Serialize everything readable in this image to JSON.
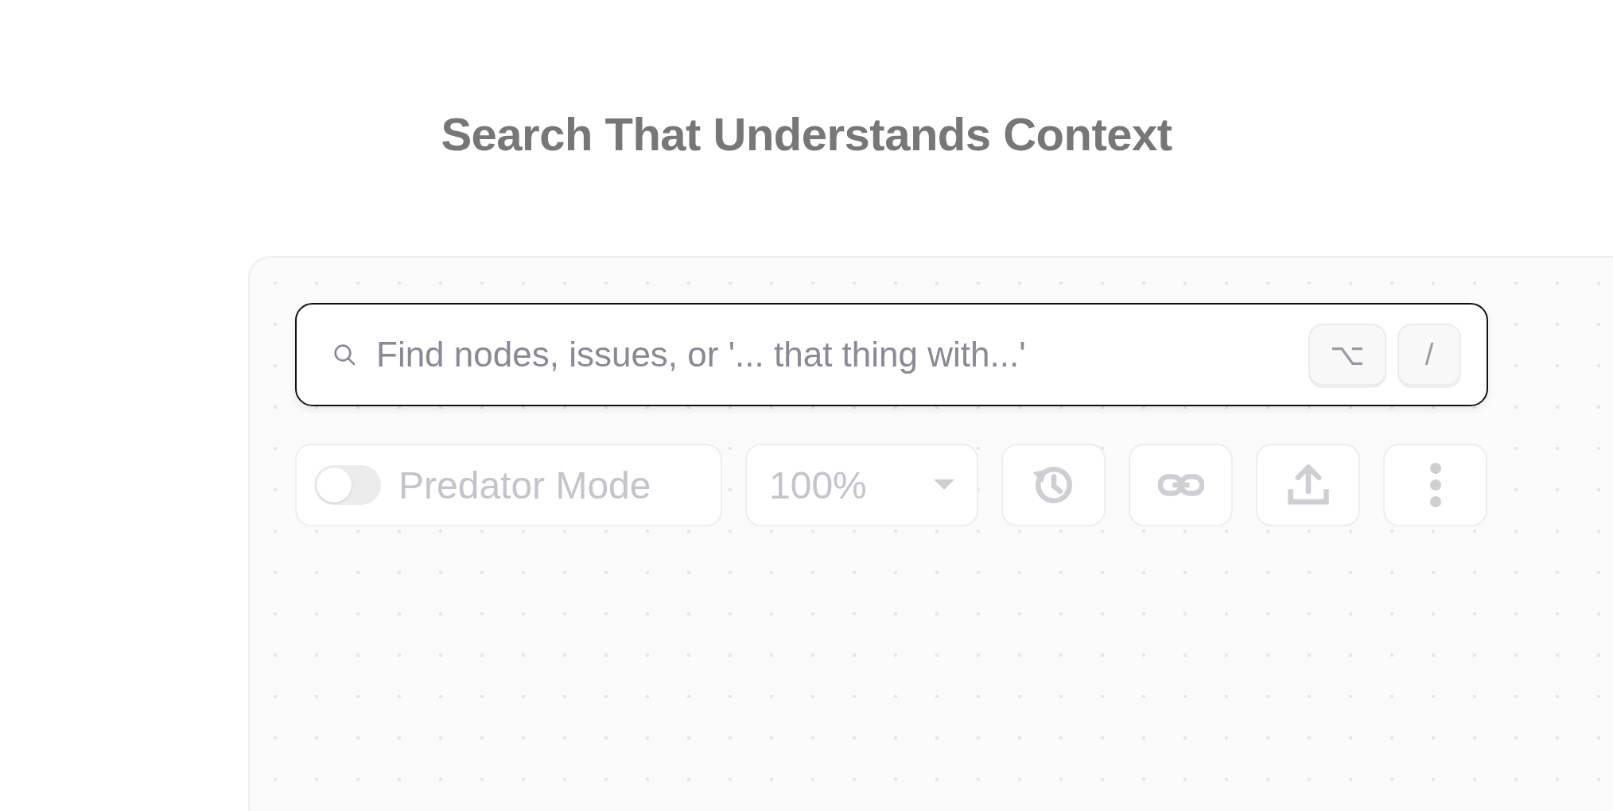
{
  "heading": "Search That Understands Context",
  "search": {
    "placeholder": "Find nodes, issues, or '... that thing with...'",
    "shortcut_keys": [
      "⌥",
      "/"
    ]
  },
  "toolbar": {
    "toggle": {
      "label": "Predator Mode",
      "on": false
    },
    "zoom": {
      "value": "100%"
    },
    "buttons": [
      {
        "kind": "history"
      },
      {
        "kind": "link"
      },
      {
        "kind": "upload"
      },
      {
        "kind": "more"
      }
    ]
  }
}
